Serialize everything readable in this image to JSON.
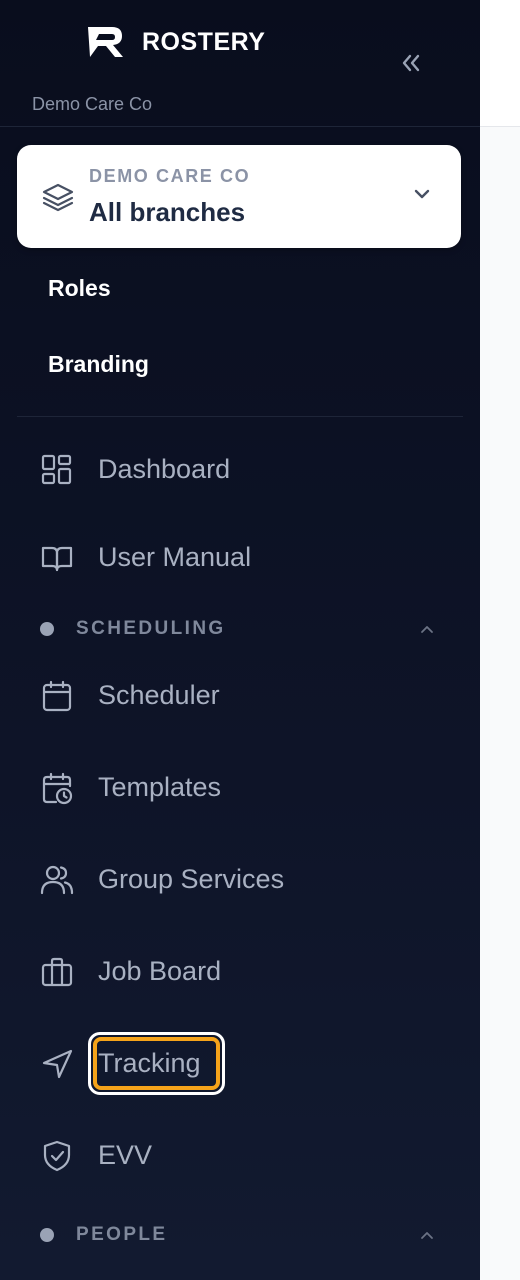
{
  "brand": {
    "name": "ROSTERY",
    "org_subtitle": "Demo Care Co"
  },
  "branch_selector": {
    "org_caption": "DEMO CARE CO",
    "branch_name": "All branches"
  },
  "org_links": [
    "Roles",
    "Branding"
  ],
  "nav": {
    "dashboard": "Dashboard",
    "user_manual": "User Manual",
    "scheduling_title": "SCHEDULING",
    "scheduler": "Scheduler",
    "templates": "Templates",
    "group_services": "Group Services",
    "job_board": "Job Board",
    "tracking": "Tracking",
    "evv": "EVV",
    "people_title": "PEOPLE"
  },
  "colors": {
    "sidebar_bg": "#0b1020",
    "highlight": "#f5a31a",
    "text_muted": "#a9b1c2",
    "card_text": "#1f2b43"
  }
}
